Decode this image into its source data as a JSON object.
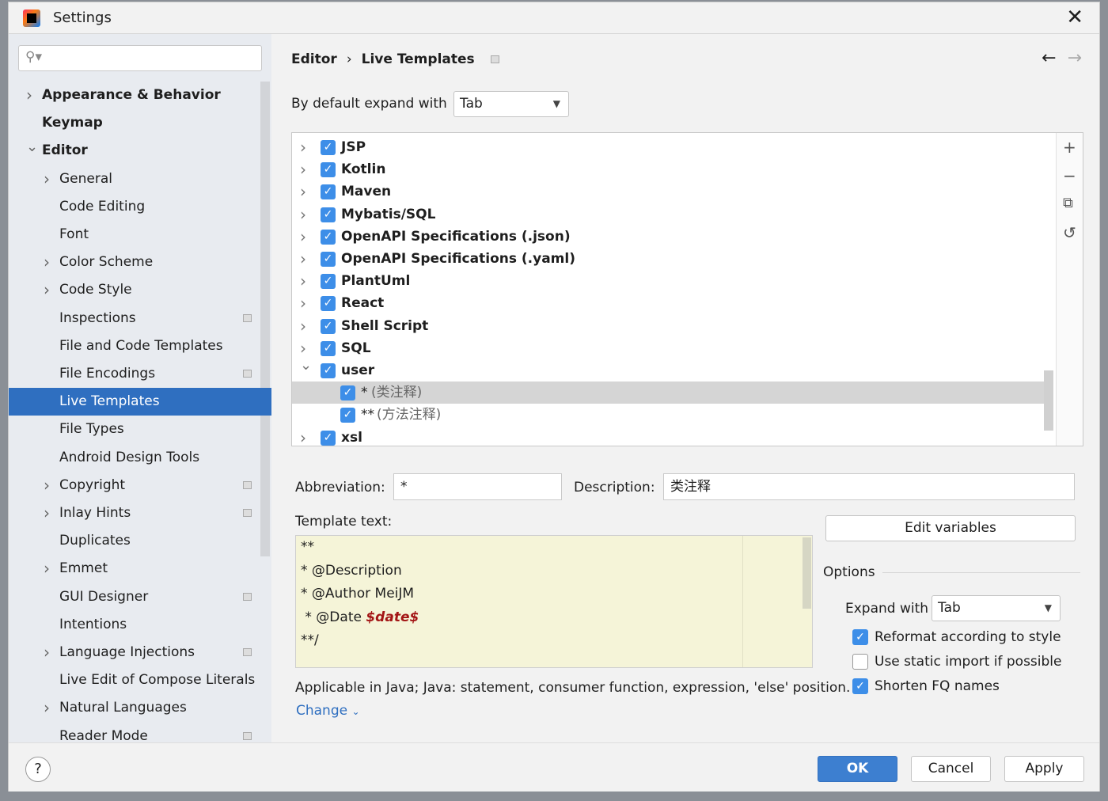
{
  "window": {
    "title": "Settings",
    "close_icon": "close-icon"
  },
  "sidebar": {
    "search_placeholder": "",
    "items": [
      {
        "label": "Appearance & Behavior",
        "bold": true,
        "chev": ">",
        "level": 0
      },
      {
        "label": "Keymap",
        "bold": true,
        "chev": "",
        "level": 0
      },
      {
        "label": "Editor",
        "bold": true,
        "chev": "v",
        "level": 0
      },
      {
        "label": "General",
        "chev": ">",
        "level": 1
      },
      {
        "label": "Code Editing",
        "chev": "",
        "level": 1
      },
      {
        "label": "Font",
        "chev": "",
        "level": 1
      },
      {
        "label": "Color Scheme",
        "chev": ">",
        "level": 1
      },
      {
        "label": "Code Style",
        "chev": ">",
        "level": 1
      },
      {
        "label": "Inspections",
        "chev": "",
        "level": 1,
        "proj": true
      },
      {
        "label": "File and Code Templates",
        "chev": "",
        "level": 1
      },
      {
        "label": "File Encodings",
        "chev": "",
        "level": 1,
        "proj": true
      },
      {
        "label": "Live Templates",
        "chev": "",
        "level": 1,
        "selected": true
      },
      {
        "label": "File Types",
        "chev": "",
        "level": 1
      },
      {
        "label": "Android Design Tools",
        "chev": "",
        "level": 1
      },
      {
        "label": "Copyright",
        "chev": ">",
        "level": 1,
        "proj": true
      },
      {
        "label": "Inlay Hints",
        "chev": ">",
        "level": 1,
        "proj": true
      },
      {
        "label": "Duplicates",
        "chev": "",
        "level": 1
      },
      {
        "label": "Emmet",
        "chev": ">",
        "level": 1
      },
      {
        "label": "GUI Designer",
        "chev": "",
        "level": 1,
        "proj": true
      },
      {
        "label": "Intentions",
        "chev": "",
        "level": 1
      },
      {
        "label": "Language Injections",
        "chev": ">",
        "level": 1,
        "proj": true
      },
      {
        "label": "Live Edit of Compose Literals",
        "chev": "",
        "level": 1
      },
      {
        "label": "Natural Languages",
        "chev": ">",
        "level": 1
      },
      {
        "label": "Reader Mode",
        "chev": "",
        "level": 1,
        "proj": true
      }
    ]
  },
  "breadcrumb": {
    "parent": "Editor",
    "sep": "›",
    "current": "Live Templates",
    "back": "←",
    "forward": "→"
  },
  "default_expand": {
    "label": "By default expand with",
    "value": "Tab"
  },
  "tree": [
    {
      "label": "JSP",
      "chev": ">",
      "checked": true
    },
    {
      "label": "Kotlin",
      "chev": ">",
      "checked": true
    },
    {
      "label": "Maven",
      "chev": ">",
      "checked": true
    },
    {
      "label": "Mybatis/SQL",
      "chev": ">",
      "checked": true
    },
    {
      "label": "OpenAPI Specifications (.json)",
      "chev": ">",
      "checked": true
    },
    {
      "label": "OpenAPI Specifications (.yaml)",
      "chev": ">",
      "checked": true
    },
    {
      "label": "PlantUml",
      "chev": ">",
      "checked": true
    },
    {
      "label": "React",
      "chev": ">",
      "checked": true
    },
    {
      "label": "Shell Script",
      "chev": ">",
      "checked": true
    },
    {
      "label": "SQL",
      "chev": ">",
      "checked": true
    },
    {
      "label": "user",
      "chev": "v",
      "checked": true
    },
    {
      "label": "*",
      "desc": "(类注释)",
      "child": true,
      "checked": true,
      "selected": true
    },
    {
      "label": "**",
      "desc": "(方法注释)",
      "child": true,
      "checked": true
    },
    {
      "label": "xsl",
      "chev": ">",
      "checked": true
    }
  ],
  "tree_tools": {
    "add": "+",
    "remove": "−",
    "copy": "⧉",
    "restore": "↺"
  },
  "form": {
    "abbreviation_label": "Abbreviation:",
    "abbreviation": "*",
    "description_label": "Description:",
    "description": "类注释",
    "template_label": "Template text:"
  },
  "template": {
    "lines": [
      "**",
      " * @Description",
      " * @Author MeiJM",
      " * @Date ",
      "**/"
    ],
    "variable": "$date$"
  },
  "applicable": "Applicable in Java; Java: statement, consumer function, expression, 'else' position.",
  "change_link": "Change",
  "edit_variables": "Edit variables",
  "options": {
    "title": "Options",
    "expand_label": "Expand with",
    "expand_value": "Tab",
    "reformat": {
      "label": "Reformat according to style",
      "checked": true
    },
    "static_import": {
      "label": "Use static import if possible",
      "checked": false
    },
    "shorten_fq": {
      "label": "Shorten FQ names",
      "checked": true
    }
  },
  "buttons": {
    "ok": "OK",
    "cancel": "Cancel",
    "apply": "Apply",
    "help": "?"
  },
  "colors": {
    "accent": "#2f6fc0",
    "checkbox": "#3d8ee8",
    "template_bg": "#f5f4d8",
    "variable": "#a31515"
  }
}
